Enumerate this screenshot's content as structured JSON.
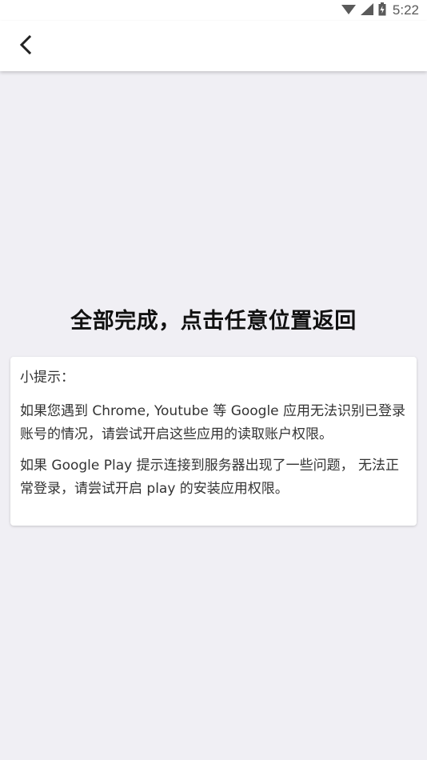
{
  "status_bar": {
    "time": "5:22",
    "icons": [
      "wifi-icon",
      "cellular-signal-icon",
      "battery-icon"
    ]
  },
  "app_bar": {
    "back_icon": "chevron-left-icon"
  },
  "main": {
    "title": "全部完成，点击任意位置返回"
  },
  "tip_card": {
    "title": "小提示：",
    "paragraphs": [
      "如果您遇到 Chrome, Youtube 等 Google 应用无法识别已登录账号的情况，请尝试开启这些应用的读取账户权限。",
      "如果 Google Play 提示连接到服务器出现了一些问题， 无法正常登录，请尝试开启 play 的安装应用权限。"
    ]
  },
  "colors": {
    "background": "#f0eff4",
    "surface": "#ffffff",
    "text_primary": "#111111",
    "text_secondary": "#333333",
    "status_icons": "#5a5a5a"
  }
}
